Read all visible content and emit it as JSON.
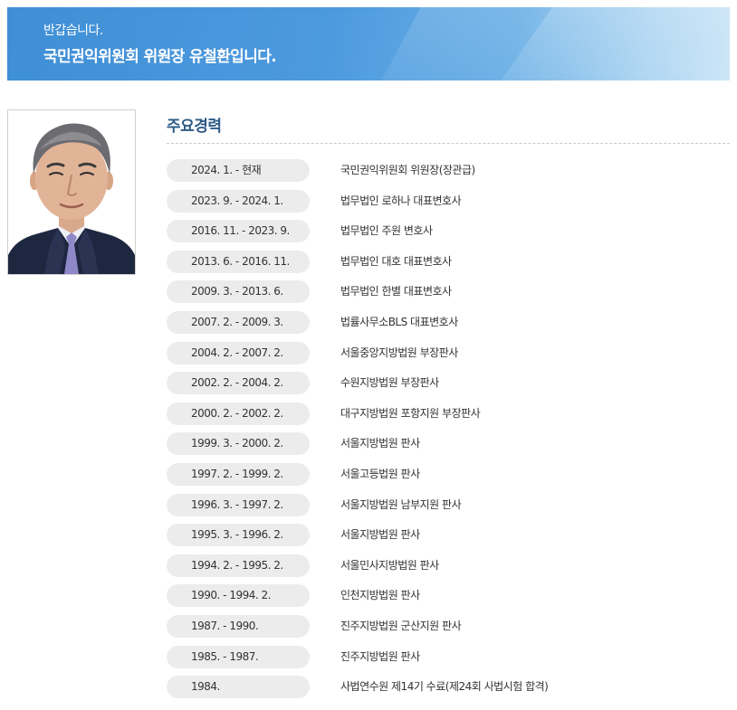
{
  "banner": {
    "greeting": "반갑습니다.",
    "welcome": "국민권익위원회 위원장 유철환입니다."
  },
  "profile": {
    "photo_alt": "유철환 위원장 사진"
  },
  "career": {
    "title": "주요경력",
    "items": [
      {
        "period": "2024. 1. - 현재",
        "description": "국민권익위원회 위원장(장관급)"
      },
      {
        "period": "2023. 9. - 2024. 1.",
        "description": "법무법인 로하나 대표변호사"
      },
      {
        "period": "2016. 11. - 2023. 9.",
        "description": "법무법인 주원 변호사"
      },
      {
        "period": "2013. 6. - 2016. 11.",
        "description": "법무법인 대호 대표변호사"
      },
      {
        "period": "2009. 3. - 2013. 6.",
        "description": "법무법인 한별 대표변호사"
      },
      {
        "period": "2007. 2. - 2009. 3.",
        "description": "법률사무소BLS 대표변호사"
      },
      {
        "period": "2004. 2. - 2007. 2.",
        "description": "서울중앙지방법원 부장판사"
      },
      {
        "period": "2002. 2. - 2004. 2.",
        "description": "수원지방법원 부장판사"
      },
      {
        "period": "2000. 2. - 2002. 2.",
        "description": "대구지방법원 포항지원 부장판사"
      },
      {
        "period": "1999. 3. - 2000. 2.",
        "description": "서울지방법원 판사"
      },
      {
        "period": "1997. 2. - 1999. 2.",
        "description": "서울고등법원 판사"
      },
      {
        "period": "1996. 3. - 1997. 2.",
        "description": "서울지방법원 남부지원 판사"
      },
      {
        "period": "1995. 3. - 1996. 2.",
        "description": "서울지방법원 판사"
      },
      {
        "period": "1994. 2. - 1995. 2.",
        "description": "서울민사지방법원 판사"
      },
      {
        "period": "1990. - 1994. 2.",
        "description": "인천지방법원 판사"
      },
      {
        "period": "1987. - 1990.",
        "description": "진주지방법원 군산지원 판사"
      },
      {
        "period": "1985. - 1987.",
        "description": "진주지방법원 판사"
      },
      {
        "period": "1984.",
        "description": "사법연수원 제14기 수료(제24회 사법시험 합격)"
      }
    ]
  },
  "colors": {
    "banner_blue": "#3f8fd6",
    "title_blue": "#2d5a86",
    "pill_gray": "#ececec"
  }
}
